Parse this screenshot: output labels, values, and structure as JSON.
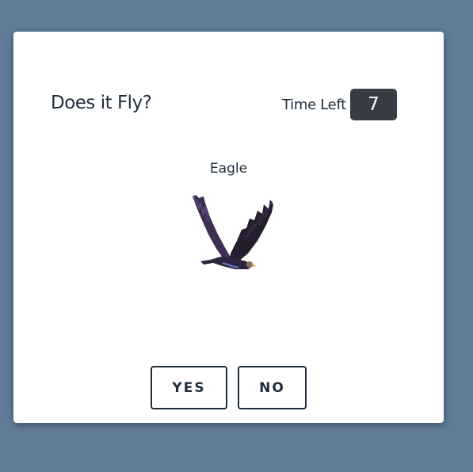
{
  "game": {
    "title": "Does it Fly?",
    "timer_label": "Time Left",
    "timer_value": "7",
    "animal_name": "Eagle",
    "animal_image": "eagle-image"
  },
  "buttons": {
    "yes_label": "YES",
    "no_label": "NO"
  },
  "colors": {
    "background": "#627d98",
    "card": "#ffffff",
    "timer_bg": "#373c45",
    "text": "#1f2d3d"
  }
}
